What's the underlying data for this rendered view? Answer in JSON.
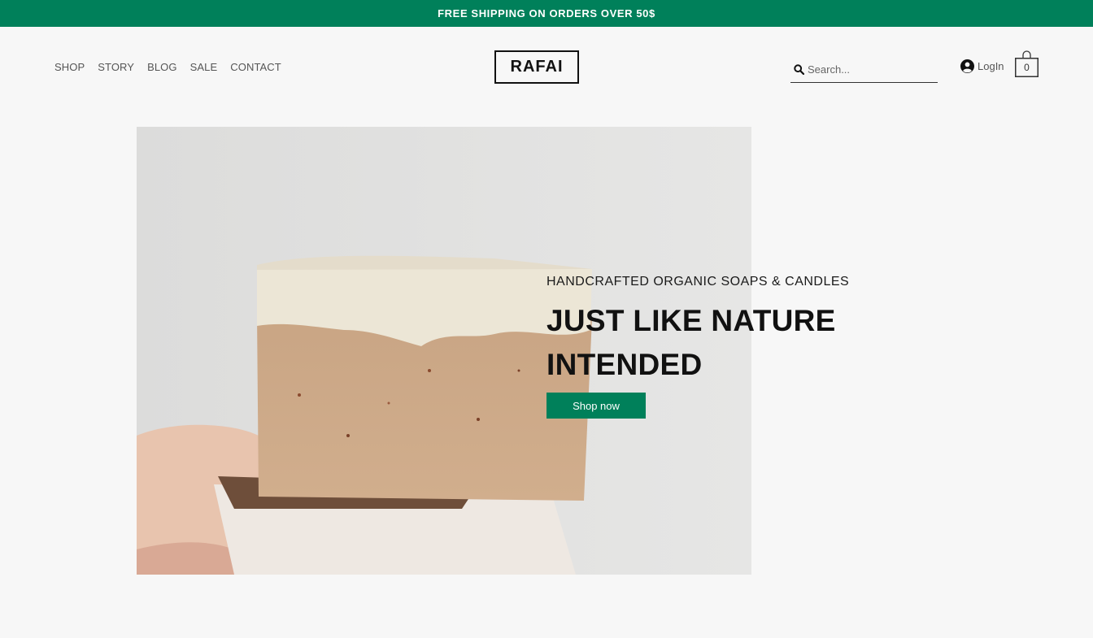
{
  "promo": {
    "text": "FREE SHIPPING ON ORDERS OVER 50$"
  },
  "nav": {
    "items": [
      {
        "label": "SHOP"
      },
      {
        "label": "STORY"
      },
      {
        "label": "BLOG"
      },
      {
        "label": "SALE"
      },
      {
        "label": "CONTACT"
      }
    ]
  },
  "brand": {
    "logo_text": "RAFAI"
  },
  "search": {
    "placeholder": "Search..."
  },
  "account": {
    "login_label": "LogIn"
  },
  "cart": {
    "count": "0"
  },
  "hero": {
    "subtitle": "HANDCRAFTED ORGANIC SOAPS & CANDLES",
    "title": "JUST LIKE NATURE INTENDED",
    "cta_label": "Shop now"
  },
  "colors": {
    "accent": "#00805a",
    "background": "#f7f7f7",
    "text": "#111111"
  },
  "icons": {
    "search": "search-icon",
    "account": "user-circle-icon",
    "cart": "shopping-bag-icon"
  }
}
